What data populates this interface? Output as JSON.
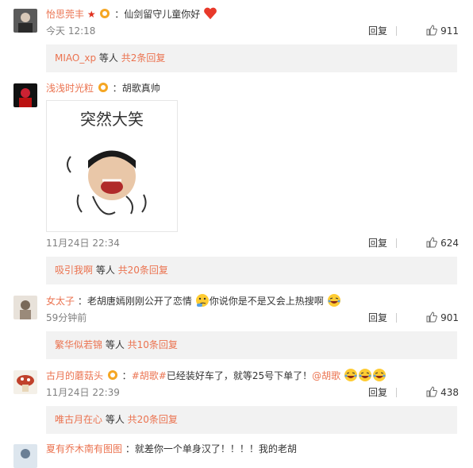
{
  "comments": [
    {
      "username": "怡思莞丰",
      "text": "仙剑留守儿童你好",
      "time": "今天 12:18",
      "reply_label": "回复",
      "likes": "911",
      "sub_who": "MIAO_xp",
      "sub_mid": " 等人 ",
      "sub_total": "共2条回复"
    },
    {
      "username": "浅浅时光粒",
      "text": "胡歌真帅",
      "time": "11月24日 22:34",
      "reply_label": "回复",
      "likes": "624",
      "sub_who": "吸引我啊",
      "sub_mid": " 等人 ",
      "sub_total": "共20条回复",
      "sticker_text": "突然大笑"
    },
    {
      "username": "女太子",
      "text_a": "老胡唐嫣刚刚公开了恋情",
      "text_b": "你说你是不是又会上热搜啊",
      "time": "59分钟前",
      "reply_label": "回复",
      "likes": "901",
      "sub_who": "繁华似若锦",
      "sub_mid": " 等人 ",
      "sub_total": "共10条回复"
    },
    {
      "username": "古月的蘑菇头",
      "hashtag": "#胡歌#",
      "text": "已经装好车了，就等25号下单了！",
      "mention": "@胡歌",
      "time": "11月24日 22:39",
      "reply_label": "回复",
      "likes": "438",
      "sub_who": "唯古月在心",
      "sub_mid": " 等人 ",
      "sub_total": "共20条回复"
    },
    {
      "username": "夏有乔木南有图图",
      "text": "就差你一个单身汉了！！！！我的老胡"
    }
  ],
  "colors": {
    "username": "#eb7350",
    "subreply_bg": "#f2f2f2"
  }
}
